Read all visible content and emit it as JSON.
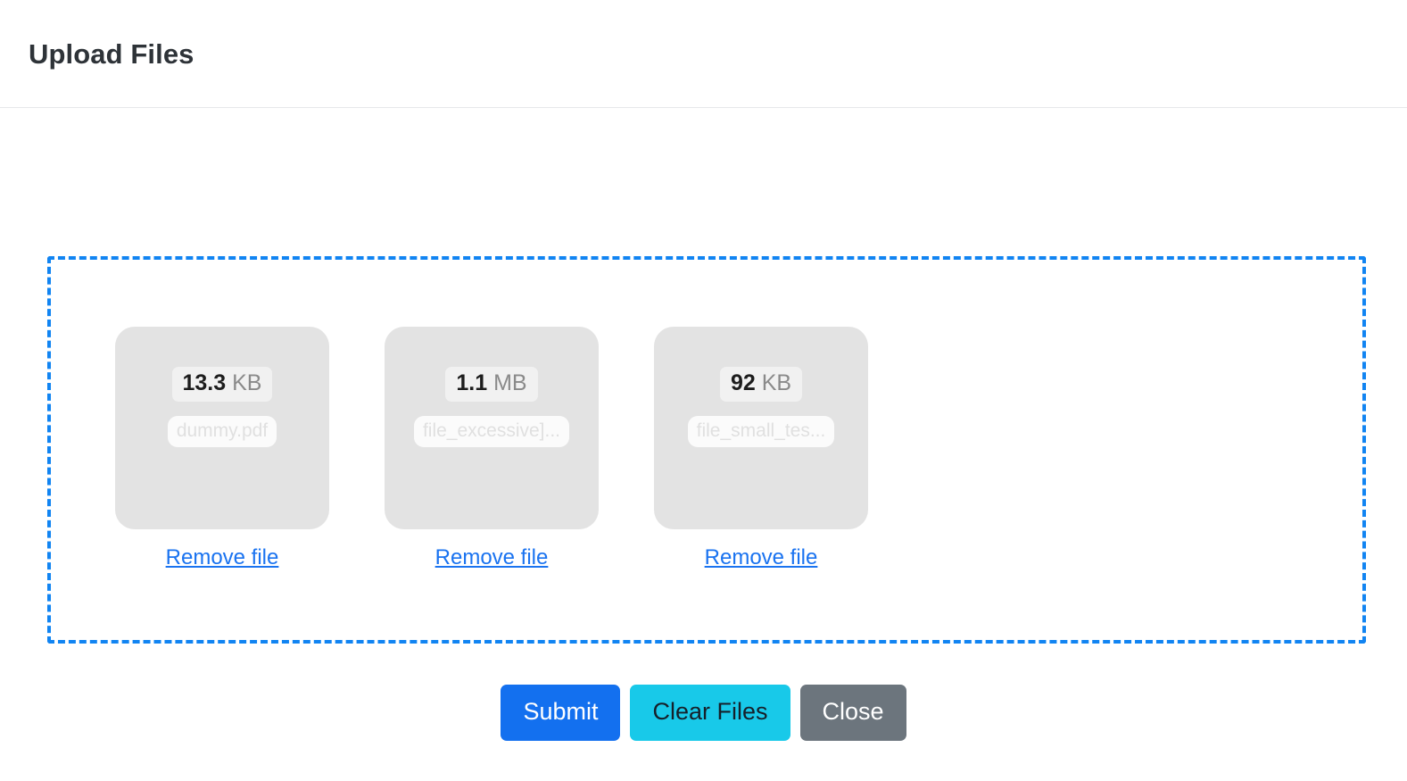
{
  "header": {
    "title": "Upload Files"
  },
  "dropzone": {
    "border_color": "#1184f2",
    "files": [
      {
        "size_value": "13.3",
        "size_unit": "KB",
        "name": "dummy.pdf",
        "remove_label": "Remove file"
      },
      {
        "size_value": "1.1",
        "size_unit": "MB",
        "name": "file_excessive]...",
        "remove_label": "Remove file"
      },
      {
        "size_value": "92",
        "size_unit": "KB",
        "name": "file_small_tes...",
        "remove_label": "Remove file"
      }
    ]
  },
  "footer": {
    "submit_label": "Submit",
    "clear_label": "Clear Files",
    "close_label": "Close",
    "submit_color": "#1370ef",
    "clear_color": "#18c9e9",
    "close_color": "#6c757d"
  }
}
